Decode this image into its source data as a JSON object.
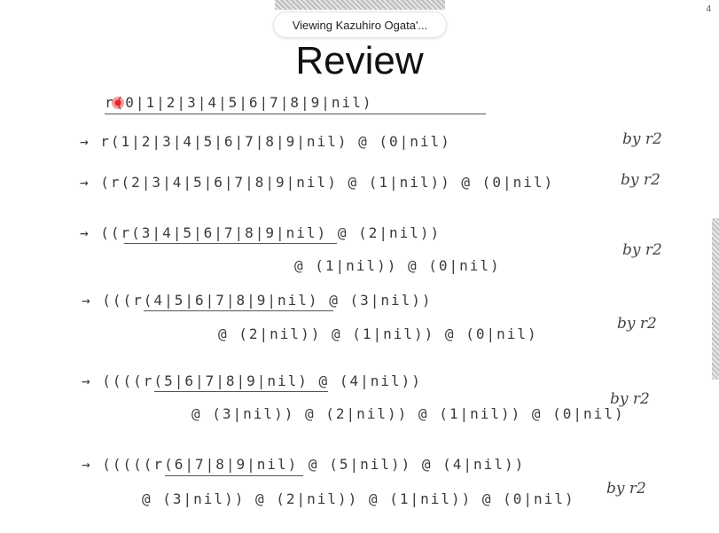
{
  "toolbar": {
    "viewing_label": "Viewing Kazuhiro Ogata'...",
    "page_number": "4"
  },
  "slide": {
    "title": "Review",
    "lines": [
      "r(0|1|2|3|4|5|6|7|8|9|nil)",
      "→ r(1|2|3|4|5|6|7|8|9|nil) @ (0|nil)",
      "→ (r(2|3|4|5|6|7|8|9|nil) @ (1|nil)) @ (0|nil)",
      "→ ((r(3|4|5|6|7|8|9|nil) @ (2|nil))",
      "@ (1|nil)) @ (0|nil)",
      "→ (((r(4|5|6|7|8|9|nil) @ (3|nil))",
      "@ (2|nil)) @ (1|nil)) @ (0|nil)",
      "→ ((((r(5|6|7|8|9|nil) @ (4|nil))",
      "@ (3|nil)) @ (2|nil)) @ (1|nil)) @ (0|nil)",
      "→ (((((r(6|7|8|9|nil) @ (5|nil)) @ (4|nil))",
      "@ (3|nil)) @ (2|nil)) @ (1|nil)) @ (0|nil)"
    ],
    "by_labels": [
      "by r2",
      "by r2",
      "by r2",
      "by r2",
      "by r2",
      "by r2"
    ]
  }
}
